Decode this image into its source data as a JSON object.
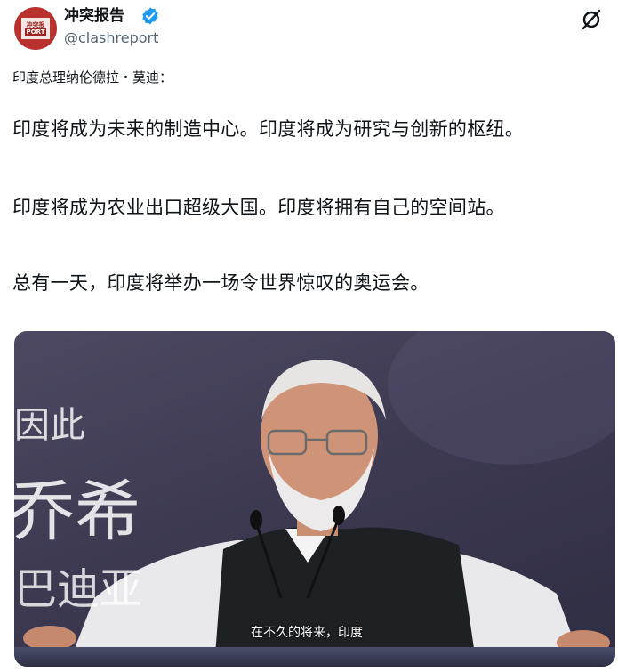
{
  "account": {
    "display_name": "冲突报告",
    "handle": "@clashreport",
    "avatar_top_text": "冲突报",
    "avatar_bottom_text": "PORT"
  },
  "tweet": {
    "intro": "印度总理纳伦德拉・莫迪：",
    "paragraphs": [
      "印度将成为未来的制造中心。印度将成为研究与创新的枢纽。",
      "印度将成为农业出口超级大国。印度将拥有自己的空间站。",
      "总有一天，印度将举办一场令世界惊叹的奥运会。"
    ]
  },
  "video": {
    "overlay_line1": "因此",
    "overlay_line2": "乔希",
    "overlay_line3": "巴迪亚",
    "subtitle": "在不久的将来，印度"
  },
  "colors": {
    "verified_blue": "#1d9bf0",
    "avatar_red": "#b8312f",
    "handle_gray": "#536471"
  },
  "icons": {
    "verified": "verified-badge-icon",
    "grok": "grok-icon"
  }
}
